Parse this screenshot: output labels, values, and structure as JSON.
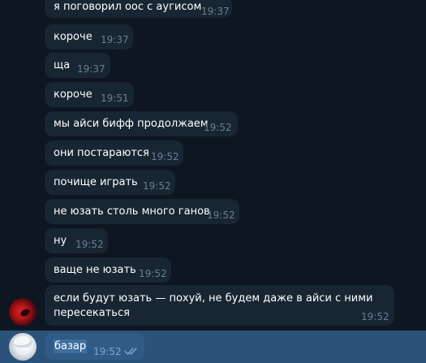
{
  "messages": [
    {
      "text": "я поговорил оос с аугисом",
      "time": "19:37"
    },
    {
      "text": "короче",
      "time": "19:37"
    },
    {
      "text": "ща",
      "time": "19:37"
    },
    {
      "text": "короче",
      "time": "19:51"
    },
    {
      "text": "мы айси бифф продолжаем",
      "time": "19:52"
    },
    {
      "text": "они постараются",
      "time": "19:52"
    },
    {
      "text": "почище играть",
      "time": "19:52"
    },
    {
      "text": "не юзать столь много ганов",
      "time": "19:52"
    },
    {
      "text": "ну",
      "time": "19:52"
    },
    {
      "text": "ваще не юзать",
      "time": "19:52"
    },
    {
      "text_line1": "если будут юзать — похуй, не будем даже в айси с ними",
      "text_line2": "пересекаться",
      "time": "19:52"
    }
  ],
  "own_message": {
    "text": "базар",
    "time": "19:52",
    "status_icon": "double-check-icon"
  },
  "colors": {
    "background": "#0e1621",
    "incoming_bubble": "#182533",
    "outgoing_bubble": "#2b5278",
    "time_text": "#6d7f8f",
    "read_check": "#7da8d3"
  }
}
